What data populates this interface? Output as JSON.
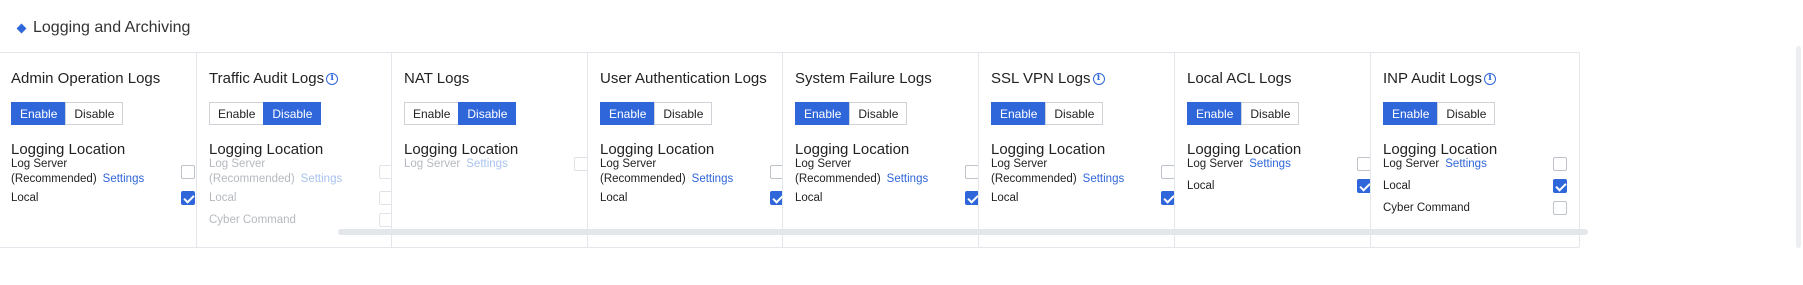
{
  "section": {
    "title": "Logging and Archiving"
  },
  "labels": {
    "enable": "Enable",
    "disable": "Disable",
    "location": "Logging Location",
    "settings": "Settings"
  },
  "cards": [
    {
      "title": "Admin Operation Logs",
      "info": false,
      "state": "enable",
      "rows": [
        {
          "label_line1": "Log Server",
          "label_line2": "(Recommended)",
          "settings": true,
          "checked": false
        },
        {
          "label_line1": "Local",
          "label_line2": "",
          "settings": false,
          "checked": true
        }
      ]
    },
    {
      "title": "Traffic Audit Logs",
      "info": true,
      "state": "disable",
      "rows": [
        {
          "label_line1": "Log Server",
          "label_line2": "(Recommended)",
          "settings": true,
          "checked": false
        },
        {
          "label_line1": "Local",
          "label_line2": "",
          "settings": false,
          "checked": false
        },
        {
          "label_line1": "Cyber Command",
          "label_line2": "",
          "settings": false,
          "checked": false
        }
      ]
    },
    {
      "title": "NAT Logs",
      "info": false,
      "state": "disable",
      "rows": [
        {
          "label_line1": "Log Server",
          "label_line2": "",
          "settings": true,
          "checked": false
        }
      ]
    },
    {
      "title": "User Authentication Logs",
      "info": false,
      "state": "enable",
      "rows": [
        {
          "label_line1": "Log Server",
          "label_line2": "(Recommended)",
          "settings": true,
          "checked": false
        },
        {
          "label_line1": "Local",
          "label_line2": "",
          "settings": false,
          "checked": true
        }
      ]
    },
    {
      "title": "System Failure Logs",
      "info": false,
      "state": "enable",
      "rows": [
        {
          "label_line1": "Log Server",
          "label_line2": "(Recommended)",
          "settings": true,
          "checked": false
        },
        {
          "label_line1": "Local",
          "label_line2": "",
          "settings": false,
          "checked": true
        }
      ]
    },
    {
      "title": "SSL VPN Logs",
      "info": true,
      "state": "enable",
      "rows": [
        {
          "label_line1": "Log Server",
          "label_line2": "(Recommended)",
          "settings": true,
          "checked": false
        },
        {
          "label_line1": "Local",
          "label_line2": "",
          "settings": false,
          "checked": true
        }
      ]
    },
    {
      "title": "Local ACL Logs",
      "info": false,
      "state": "enable",
      "rows": [
        {
          "label_line1": "Log Server",
          "label_line2": "",
          "settings": true,
          "checked": false
        },
        {
          "label_line1": "Local",
          "label_line2": "",
          "settings": false,
          "checked": true
        }
      ]
    },
    {
      "title": "INP Audit Logs",
      "info": true,
      "state": "enable",
      "rows": [
        {
          "label_line1": "Log Server",
          "label_line2": "",
          "settings": true,
          "checked": false
        },
        {
          "label_line1": "Local",
          "label_line2": "",
          "settings": false,
          "checked": true
        },
        {
          "label_line1": "Cyber Command",
          "label_line2": "",
          "settings": false,
          "checked": false
        }
      ]
    }
  ],
  "colors": {
    "accent": "#2f66d9",
    "border": "#e3e6ea"
  },
  "icons": {
    "section": "diamond-icon",
    "info": "info-icon"
  }
}
